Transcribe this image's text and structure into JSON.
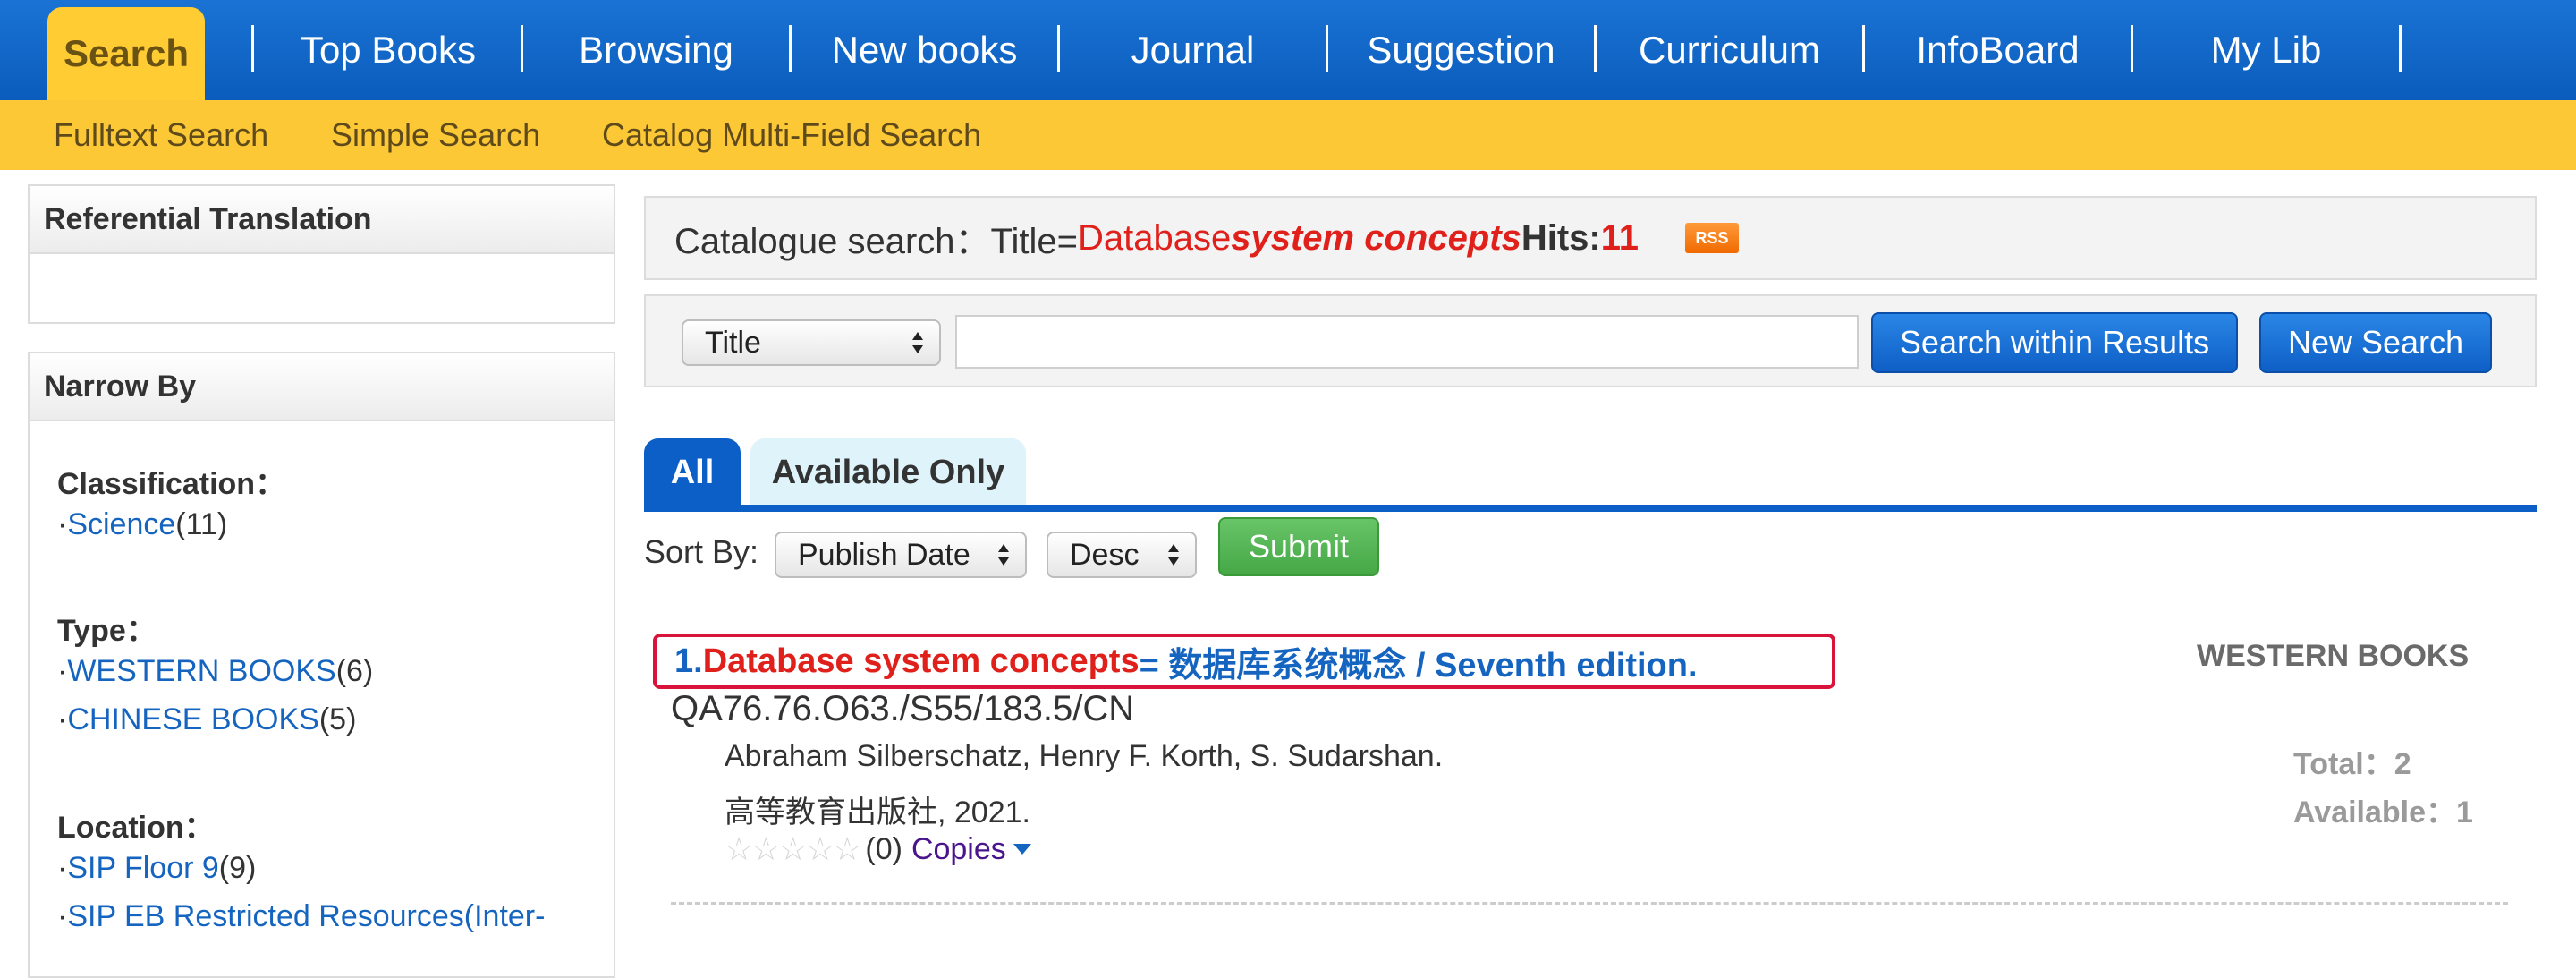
{
  "nav": {
    "tabs": [
      {
        "label": "Search",
        "active": true
      },
      {
        "label": "Top Books"
      },
      {
        "label": "Browsing"
      },
      {
        "label": "New books"
      },
      {
        "label": "Journal"
      },
      {
        "label": "Suggestion"
      },
      {
        "label": "Curriculum"
      },
      {
        "label": "InfoBoard"
      },
      {
        "label": "My Lib"
      }
    ],
    "subtabs": [
      "Fulltext Search",
      "Simple Search",
      "Catalog Multi-Field Search"
    ]
  },
  "sidebar": {
    "translation_title": "Referential Translation",
    "narrow_title": "Narrow By",
    "facets": [
      {
        "title": "Classification：",
        "items": [
          {
            "label": "Science",
            "count": "(11)"
          }
        ]
      },
      {
        "title": "Type：",
        "items": [
          {
            "label": "WESTERN BOOKS",
            "count": "(6)"
          },
          {
            "label": "CHINESE BOOKS",
            "count": "(5)"
          }
        ]
      },
      {
        "title": "Location：",
        "items": [
          {
            "label": "SIP Floor 9",
            "count": "(9)"
          },
          {
            "label": "SIP EB Restricted Resources(Inter-",
            "count": ""
          }
        ]
      }
    ]
  },
  "search": {
    "prefix": "Catalogue search：Title=",
    "term_plain": "Database ",
    "term_emph": "system concepts",
    "hits_label": " Hits:",
    "hits": "11",
    "rss": "RSS"
  },
  "filter": {
    "field_value": "Title",
    "input_value": "",
    "search_within_label": "Search within Results",
    "new_search_label": "New Search"
  },
  "result_tabs": {
    "all": "All",
    "available": "Available Only"
  },
  "sort": {
    "label": "Sort By:",
    "field": "Publish Date",
    "order": "Desc",
    "submit": "Submit"
  },
  "results": [
    {
      "num": "1.",
      "title_red": "Database system concepts",
      "title_rest": " = 数据库系统概念 / Seventh edition.",
      "call_number": "QA76.76.O63./S55/183.5/CN",
      "authors": "Abraham Silberschatz, Henry F. Korth, S. Sudarshan.",
      "publisher": "高等教育出版社, 2021.",
      "stars": "☆☆☆☆☆",
      "rating_count": "(0)",
      "copies_label": "Copies",
      "type": "WESTERN BOOKS",
      "total": "Total：2",
      "available": "Available：1"
    }
  ]
}
